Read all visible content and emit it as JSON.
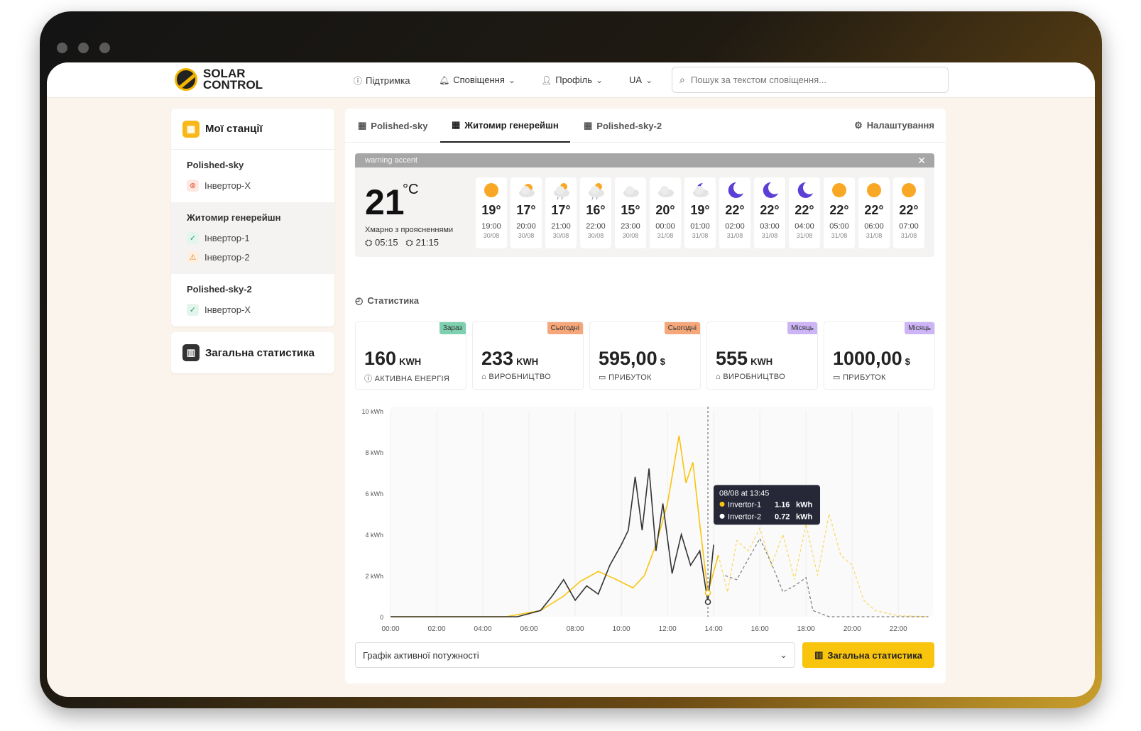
{
  "brand": {
    "line1": "SOLAR",
    "line2": "CONTROL"
  },
  "nav": {
    "support": "Підтримка",
    "notifications": "Сповіщення",
    "profile": "Профіль",
    "lang": "UA"
  },
  "search": {
    "placeholder": "Пошук за текстом сповіщення..."
  },
  "sidebar": {
    "title": "Мої станції",
    "stations": [
      {
        "name": "Polished-sky",
        "inverters": [
          {
            "name": "Інвертор-X",
            "status": "error"
          }
        ]
      },
      {
        "name": "Житомир генерейшн",
        "inverters": [
          {
            "name": "Інвертор-1",
            "status": "ok"
          },
          {
            "name": "Інвертор-2",
            "status": "warning"
          }
        ]
      },
      {
        "name": "Polished-sky-2",
        "inverters": [
          {
            "name": "Інвертор-X",
            "status": "ok"
          }
        ]
      }
    ],
    "stats_label": "Загальна статистика"
  },
  "tabs": [
    "Polished-sky",
    "Житомир генерейшн",
    "Polished-sky-2"
  ],
  "settings_label": "Налаштування",
  "weather": {
    "bar": "warning accent",
    "temp": "21",
    "unit": "°C",
    "condition": "Хмарно з проясненнями",
    "sunrise": "05:15",
    "sunset": "21:15",
    "forecast": [
      {
        "t": "19°",
        "h": "19:00",
        "d": "30/08",
        "icon": "sun"
      },
      {
        "t": "17°",
        "h": "20:00",
        "d": "30/08",
        "icon": "partly-cloudy"
      },
      {
        "t": "17°",
        "h": "21:00",
        "d": "30/08",
        "icon": "rain-sun"
      },
      {
        "t": "16°",
        "h": "22:00",
        "d": "30/08",
        "icon": "rain-sun"
      },
      {
        "t": "15°",
        "h": "23:00",
        "d": "30/08",
        "icon": "cloud"
      },
      {
        "t": "20°",
        "h": "00:00",
        "d": "31/08",
        "icon": "cloud"
      },
      {
        "t": "19°",
        "h": "01:00",
        "d": "31/08",
        "icon": "moon-cloud"
      },
      {
        "t": "22°",
        "h": "02:00",
        "d": "31/08",
        "icon": "moon"
      },
      {
        "t": "22°",
        "h": "03:00",
        "d": "31/08",
        "icon": "moon"
      },
      {
        "t": "22°",
        "h": "04:00",
        "d": "31/08",
        "icon": "moon"
      },
      {
        "t": "22°",
        "h": "05:00",
        "d": "31/08",
        "icon": "sun"
      },
      {
        "t": "22°",
        "h": "06:00",
        "d": "31/08",
        "icon": "sun"
      },
      {
        "t": "22°",
        "h": "07:00",
        "d": "31/08",
        "icon": "sun"
      }
    ]
  },
  "stats_title": "Статистика",
  "kpis": [
    {
      "value": "160",
      "unit": "KWH",
      "label": "АКТИВНА ЕНЕРГІЯ",
      "tag": "Зараз",
      "tag_color": "#7fd0b0"
    },
    {
      "value": "233",
      "unit": "KWH",
      "label": "ВИРОБНИЦТВО",
      "tag": "Сьогодні",
      "tag_color": "#f5a77a"
    },
    {
      "value": "595,00",
      "unit": "$",
      "label": "ПРИБУТОК",
      "tag": "Сьогодні",
      "tag_color": "#f5a77a"
    },
    {
      "value": "555",
      "unit": "KWH",
      "label": "ВИРОБНИЦТВО",
      "tag": "Місяць",
      "tag_color": "#cdb4f5"
    },
    {
      "value": "1000,00",
      "unit": "$",
      "label": "ПРИБУТОК",
      "tag": "Місяць",
      "tag_color": "#cdb4f5"
    }
  ],
  "chart_data": {
    "type": "line",
    "y_ticks": [
      "10 kWh",
      "8 kWh",
      "6 kWh",
      "4 kWh",
      "2 kWh",
      "0"
    ],
    "x_ticks": [
      "00:00",
      "02:00",
      "04:00",
      "06:00",
      "08:00",
      "10:00",
      "12:00",
      "14:00",
      "16:00",
      "18:00",
      "20:00",
      "22:00"
    ],
    "ylim": [
      0,
      10
    ],
    "xlim": [
      0,
      23.5
    ],
    "series": [
      {
        "name": "Invertor-1",
        "color": "#f9c40d",
        "points": [
          [
            0,
            0
          ],
          [
            5,
            0
          ],
          [
            6.5,
            0.3
          ],
          [
            7.5,
            1
          ],
          [
            8.2,
            1.7
          ],
          [
            9,
            2.2
          ],
          [
            9.8,
            1.8
          ],
          [
            10.5,
            1.4
          ],
          [
            11,
            2
          ],
          [
            11.5,
            3.5
          ],
          [
            12,
            5.5
          ],
          [
            12.5,
            8.8
          ],
          [
            12.8,
            6.5
          ],
          [
            13.1,
            7.5
          ],
          [
            13.4,
            4.5
          ],
          [
            13.75,
            1.16
          ],
          [
            14.2,
            3
          ],
          [
            14.6,
            1.2
          ],
          [
            15,
            3.7
          ],
          [
            15.5,
            3.2
          ],
          [
            16,
            4.3
          ],
          [
            16.5,
            2.5
          ],
          [
            17,
            4
          ],
          [
            17.5,
            1.8
          ],
          [
            18,
            4.5
          ],
          [
            18.5,
            2
          ],
          [
            19,
            5
          ],
          [
            19.5,
            3
          ],
          [
            20,
            2.5
          ],
          [
            20.5,
            0.8
          ],
          [
            21,
            0.3
          ],
          [
            22,
            0.05
          ],
          [
            23.3,
            0
          ]
        ]
      },
      {
        "name": "Invertor-2",
        "color": "#333333",
        "points": [
          [
            0,
            0
          ],
          [
            5.5,
            0
          ],
          [
            6.5,
            0.3
          ],
          [
            7,
            1
          ],
          [
            7.5,
            1.8
          ],
          [
            8,
            0.8
          ],
          [
            8.5,
            1.5
          ],
          [
            9,
            1.1
          ],
          [
            9.5,
            2.5
          ],
          [
            10,
            3.5
          ],
          [
            10.3,
            4.2
          ],
          [
            10.6,
            6.8
          ],
          [
            10.9,
            4.2
          ],
          [
            11.2,
            7.2
          ],
          [
            11.5,
            3.2
          ],
          [
            11.8,
            5.5
          ],
          [
            12.2,
            2.1
          ],
          [
            12.6,
            4
          ],
          [
            13,
            2.5
          ],
          [
            13.4,
            3.2
          ],
          [
            13.75,
            0.72
          ],
          [
            14,
            3.5
          ],
          [
            14.5,
            2
          ],
          [
            15,
            1.8
          ],
          [
            15.5,
            2.8
          ],
          [
            16,
            3.8
          ],
          [
            16.5,
            2.6
          ],
          [
            17,
            1.2
          ],
          [
            17.5,
            1.5
          ],
          [
            18,
            1.9
          ],
          [
            18.3,
            0.3
          ],
          [
            19,
            0
          ],
          [
            23.3,
            0
          ]
        ]
      }
    ],
    "tooltip": {
      "title": "08/08 at 13:45",
      "rows": [
        {
          "name": "Invertor-1",
          "value": "1.16",
          "unit": "kWh"
        },
        {
          "name": "Invertor-2",
          "value": "0.72",
          "unit": "kWh"
        }
      ]
    },
    "cursor_time": 13.75
  },
  "chart_select": "Графік активної потужності",
  "cta_label": "Загальна статистика"
}
